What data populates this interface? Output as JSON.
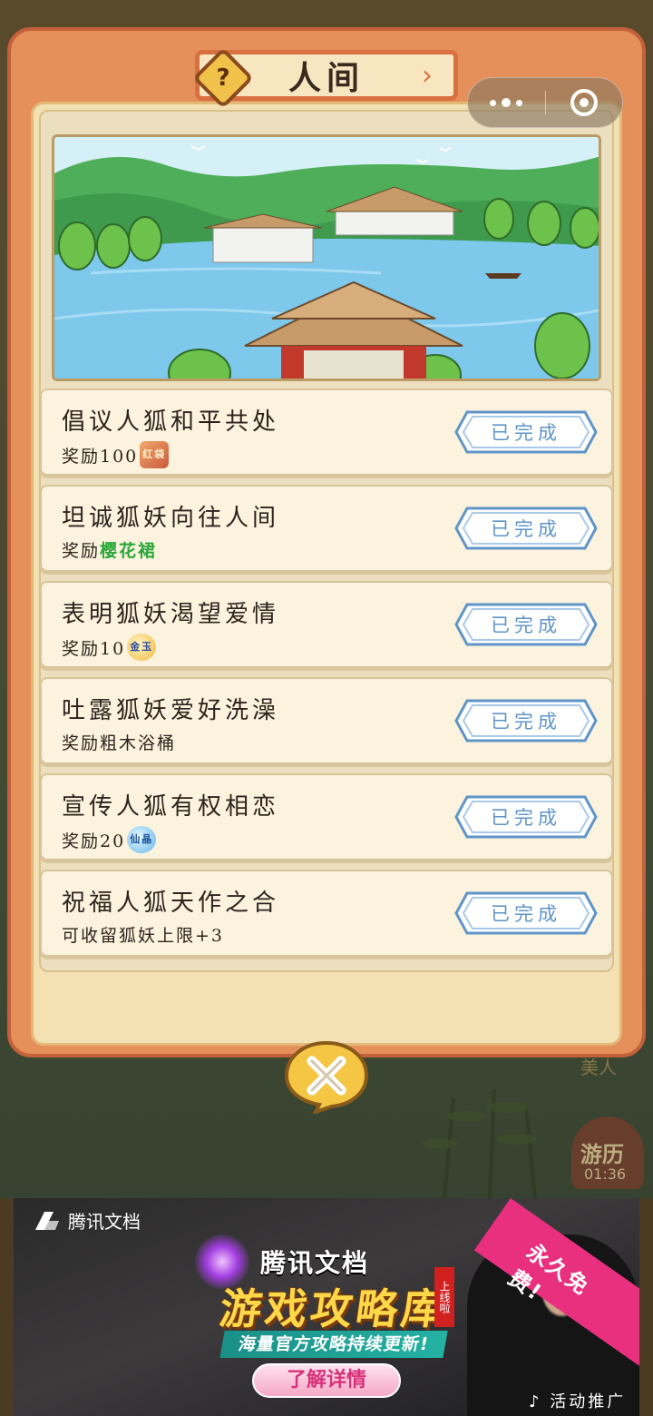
{
  "panel": {
    "title": "人间",
    "help_symbol": "?"
  },
  "tasks": [
    {
      "title": "倡议人狐和平共处",
      "reward_prefix": "奖励100",
      "reward_item": "",
      "reward_icon_text": "红袋",
      "done_label": "已完成"
    },
    {
      "title": "坦诚狐妖向往人间",
      "reward_prefix": "奖励",
      "reward_item": "樱花裙",
      "reward_icon_text": "",
      "done_label": "已完成"
    },
    {
      "title": "表明狐妖渴望爱情",
      "reward_prefix": "奖励10",
      "reward_item": "",
      "reward_icon_text": "金玉",
      "done_label": "已完成"
    },
    {
      "title": "吐露狐妖爱好洗澡",
      "reward_prefix": "奖励粗木浴桶",
      "reward_item": "",
      "reward_icon_text": "",
      "done_label": "已完成"
    },
    {
      "title": "宣传人狐有权相恋",
      "reward_prefix": "奖励20",
      "reward_item": "",
      "reward_icon_text": "仙晶",
      "done_label": "已完成"
    },
    {
      "title": "祝福人狐天作之合",
      "reward_prefix": "可收留狐妖上限+3",
      "reward_item": "",
      "reward_icon_text": "",
      "done_label": "已完成"
    }
  ],
  "background": {
    "badge_title": "游历",
    "badge_time": "01:36",
    "side_text_1": "美人"
  },
  "ad": {
    "brand": "腾讯文档",
    "title_small": "腾讯文档",
    "title_big": "游戏攻略库",
    "stamp": "上线啦",
    "subtitle": "海量官方攻略持续更新!",
    "cta": "了解详情",
    "corner": "永久免费!",
    "tag": "活动推广"
  },
  "colors": {
    "panel_orange": "#e58f5a",
    "paper": "#fbf3de",
    "done_blue": "#5f95c9",
    "reward_green": "#2aa83a"
  }
}
